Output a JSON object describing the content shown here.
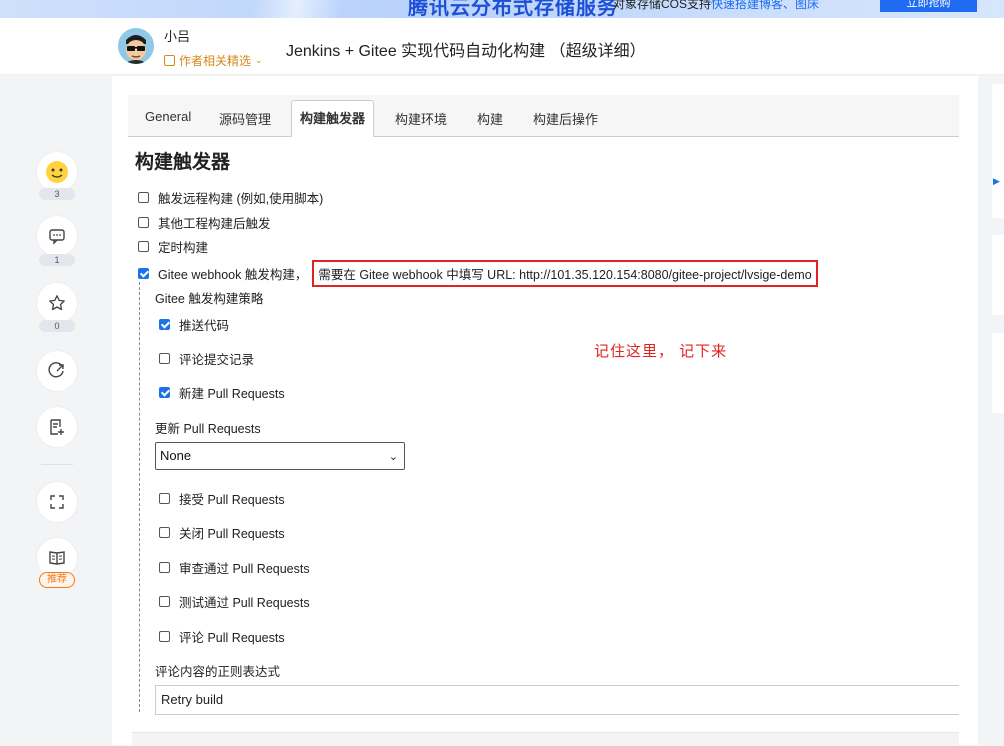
{
  "banner": {
    "headline": "腾讯云分布式存储服务",
    "subtext": "对象存储COS支持",
    "subtext_link": "快速搭建博客、图床",
    "buy_label": "立即抢购"
  },
  "header": {
    "author_name": "小吕",
    "author_tag": "作者相关精选",
    "article_title": "Jenkins + Gitee 实现代码自动化构建 （超级详细）"
  },
  "toolbar": {
    "like_count": "3",
    "comment_count": "1",
    "star_count": "0",
    "recommend_label": "推荐"
  },
  "jenkins": {
    "tabs": [
      "General",
      "源码管理",
      "构建触发器",
      "构建环境",
      "构建",
      "构建后操作"
    ],
    "active_tab": "构建触发器",
    "section_title": "构建触发器",
    "triggers": [
      {
        "label": "触发远程构建 (例如,使用脚本)",
        "checked": false
      },
      {
        "label": "其他工程构建后触发",
        "checked": false
      },
      {
        "label": "定时构建",
        "checked": false
      },
      {
        "label": "Gitee webhook 触发构建，",
        "checked": true
      }
    ],
    "webhook_url_note": "需要在 Gitee webhook 中填写 URL: http://101.35.120.154:8080/gitee-project/lvsige-demo",
    "strategy_label": "Gitee 触发构建策略",
    "strategy_options": [
      {
        "label": "推送代码",
        "checked": true
      },
      {
        "label": "评论提交记录",
        "checked": false
      },
      {
        "label": "新建 Pull Requests",
        "checked": true
      }
    ],
    "update_pr_label": "更新 Pull Requests",
    "update_pr_select_value": "None",
    "pr_options": [
      {
        "label": "接受 Pull Requests",
        "checked": false
      },
      {
        "label": "关闭 Pull Requests",
        "checked": false
      },
      {
        "label": "审查通过 Pull Requests",
        "checked": false
      },
      {
        "label": "测试通过 Pull Requests",
        "checked": false
      },
      {
        "label": "评论 Pull Requests",
        "checked": false
      }
    ],
    "comment_regex_label": "评论内容的正则表达式",
    "comment_regex_value": "Retry build"
  },
  "annotation": {
    "note": "记住这里， 记下来",
    "color": "#e02424"
  }
}
